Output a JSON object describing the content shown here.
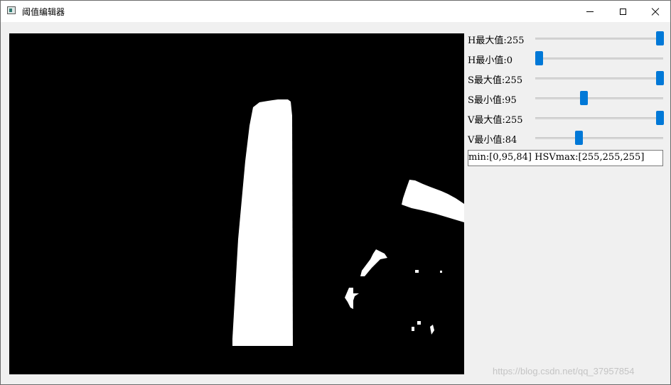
{
  "window": {
    "title": "阈值编辑器",
    "icon": "app-window-icon",
    "controls": [
      "minimize-icon",
      "maximize-icon",
      "close-icon"
    ]
  },
  "sliders": [
    {
      "label": "H最大值:255",
      "value": 255,
      "min": 0,
      "max": 255
    },
    {
      "label": "H最小值:0",
      "value": 0,
      "min": 0,
      "max": 255
    },
    {
      "label": "S最大值:255",
      "value": 255,
      "min": 0,
      "max": 255
    },
    {
      "label": "S最小值:95",
      "value": 95,
      "min": 0,
      "max": 255
    },
    {
      "label": "V最大值:255",
      "value": 255,
      "min": 0,
      "max": 255
    },
    {
      "label": "V最小值:84",
      "value": 84,
      "min": 0,
      "max": 255
    }
  ],
  "result": {
    "text": "min:[0,95,84] HSVmax:[255,255,255]"
  },
  "watermark": "https://blog.csdn.net/qq_37957854",
  "colors": {
    "accent": "#0078d7",
    "image_background": "#000000",
    "mask_foreground": "#ffffff"
  }
}
